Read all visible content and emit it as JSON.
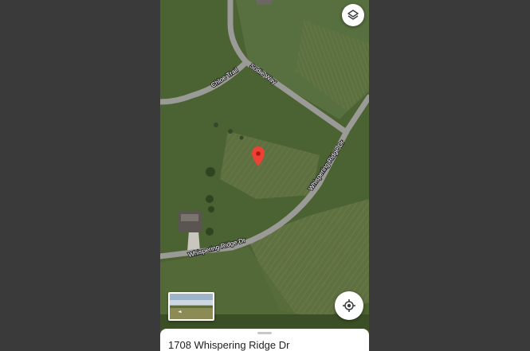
{
  "map": {
    "roads": [
      {
        "id": "chloe-trail",
        "label": "Chloe Trail"
      },
      {
        "id": "sodie-way",
        "label": "Sodie Way"
      },
      {
        "id": "whispering-ridge-dr-east",
        "label": "Whispering Ridge Dr"
      },
      {
        "id": "whispering-ridge-dr-south",
        "label": "Whispering Ridge Dr"
      }
    ],
    "pin_color": "#ea4335",
    "map_type": "satellite"
  },
  "controls": {
    "layers_icon": "layers-icon",
    "locate_icon": "my-location-icon"
  },
  "street_view": {
    "icon": "street-view-thumbnail"
  },
  "sheet": {
    "address": "1708 Whispering Ridge Dr"
  }
}
